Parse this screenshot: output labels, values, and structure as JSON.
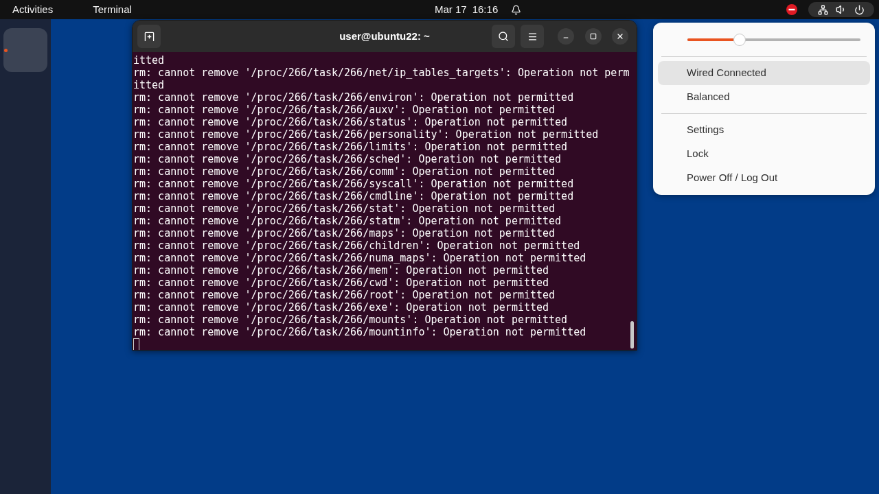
{
  "top_bar": {
    "activities": "Activities",
    "app_menu": "Terminal",
    "clock": {
      "date": "Mar 17",
      "time": "16:16"
    },
    "status_area": {
      "open": true
    }
  },
  "dock": {
    "items": [
      {
        "running": true
      }
    ]
  },
  "terminal": {
    "title": "user@ubuntu22: ~",
    "lines": [
      "itted",
      "rm: cannot remove '/proc/266/task/266/net/ip_tables_targets': Operation not perm",
      "itted",
      "rm: cannot remove '/proc/266/task/266/environ': Operation not permitted",
      "rm: cannot remove '/proc/266/task/266/auxv': Operation not permitted",
      "rm: cannot remove '/proc/266/task/266/status': Operation not permitted",
      "rm: cannot remove '/proc/266/task/266/personality': Operation not permitted",
      "rm: cannot remove '/proc/266/task/266/limits': Operation not permitted",
      "rm: cannot remove '/proc/266/task/266/sched': Operation not permitted",
      "rm: cannot remove '/proc/266/task/266/comm': Operation not permitted",
      "rm: cannot remove '/proc/266/task/266/syscall': Operation not permitted",
      "rm: cannot remove '/proc/266/task/266/cmdline': Operation not permitted",
      "rm: cannot remove '/proc/266/task/266/stat': Operation not permitted",
      "rm: cannot remove '/proc/266/task/266/statm': Operation not permitted",
      "rm: cannot remove '/proc/266/task/266/maps': Operation not permitted",
      "rm: cannot remove '/proc/266/task/266/children': Operation not permitted",
      "rm: cannot remove '/proc/266/task/266/numa_maps': Operation not permitted",
      "rm: cannot remove '/proc/266/task/266/mem': Operation not permitted",
      "rm: cannot remove '/proc/266/task/266/cwd': Operation not permitted",
      "rm: cannot remove '/proc/266/task/266/root': Operation not permitted",
      "rm: cannot remove '/proc/266/task/266/exe': Operation not permitted",
      "rm: cannot remove '/proc/266/task/266/mounts': Operation not permitted",
      "rm: cannot remove '/proc/266/task/266/mountinfo': Operation not permitted"
    ]
  },
  "system_menu": {
    "slider": {
      "level": 0.3
    },
    "sections": [
      {
        "items": [
          {
            "label": "Wired Connected",
            "highlighted": true
          },
          {
            "label": "Balanced",
            "highlighted": false
          }
        ]
      },
      {
        "items": [
          {
            "label": "Settings",
            "highlighted": false
          },
          {
            "label": "Lock",
            "highlighted": false
          },
          {
            "label": "Power Off / Log Out",
            "highlighted": false
          }
        ]
      }
    ]
  }
}
